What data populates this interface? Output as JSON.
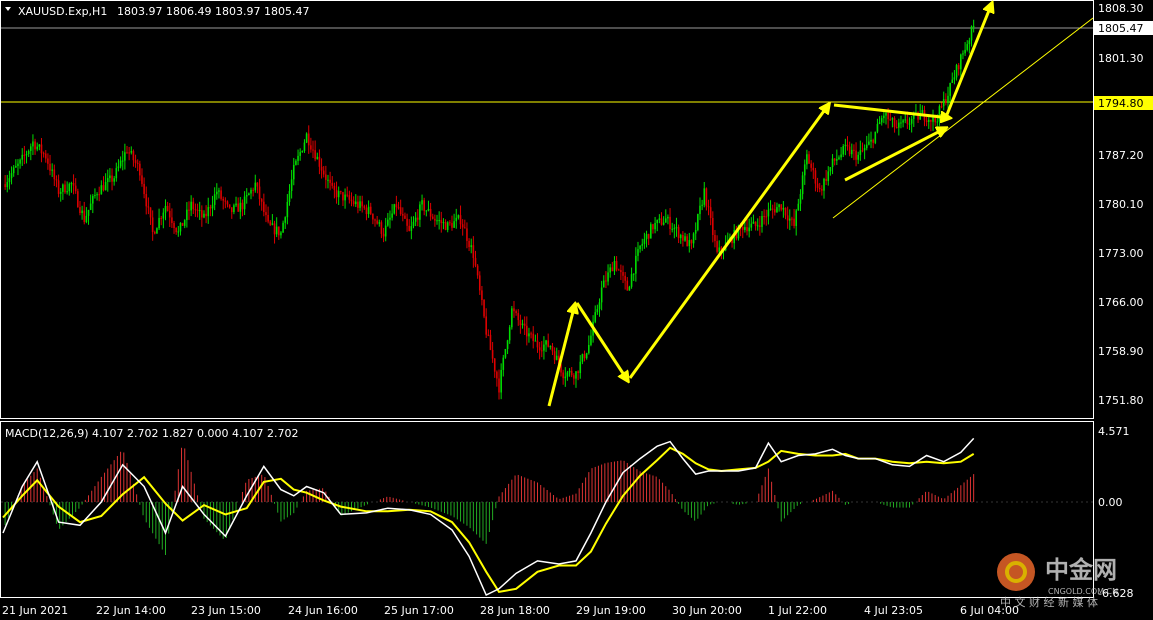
{
  "header": {
    "symbol": "XAUUSD.Exp,H1",
    "ohlc": "1803.97 1806.49 1803.97 1805.47"
  },
  "colors": {
    "background": "#000000",
    "grid_border": "#ffffff",
    "bull": "#00dd00",
    "bear": "#dd0000",
    "annotation": "#ffff00",
    "current_price_line": "#aaaaaa",
    "macd_line": "#ffffff",
    "signal_line": "#ffff00",
    "hist_pos": "#dd3333",
    "hist_neg": "#22aa22"
  },
  "chart_data": [
    {
      "type": "candlestick",
      "title": "XAUUSD.Exp,H1",
      "ylim": [
        1748.5,
        1809.3
      ],
      "y_ticks": [
        "1808.30",
        "1801.30",
        "1787.20",
        "1780.10",
        "1773.00",
        "1766.00",
        "1758.90",
        "1751.80"
      ],
      "x_ticks": [
        "21 Jun 2021",
        "22 Jun 14:00",
        "23 Jun 15:00",
        "24 Jun 16:00",
        "25 Jun 17:00",
        "28 Jun 18:00",
        "29 Jun 19:00",
        "30 Jun 20:00",
        "1 Jul 22:00",
        "4 Jul 23:05",
        "6 Jul 04:00"
      ],
      "current_price": "1805.47",
      "horizontal_level": "1794.80",
      "anchors": [
        [
          0,
          1783
        ],
        [
          8,
          1786
        ],
        [
          14,
          1789
        ],
        [
          20,
          1787
        ],
        [
          26,
          1782
        ],
        [
          32,
          1783
        ],
        [
          38,
          1778
        ],
        [
          44,
          1782
        ],
        [
          52,
          1784
        ],
        [
          58,
          1788
        ],
        [
          64,
          1785
        ],
        [
          70,
          1776
        ],
        [
          76,
          1780
        ],
        [
          82,
          1776
        ],
        [
          88,
          1780
        ],
        [
          94,
          1778
        ],
        [
          100,
          1782
        ],
        [
          106,
          1779
        ],
        [
          112,
          1780
        ],
        [
          118,
          1783
        ],
        [
          124,
          1777
        ],
        [
          130,
          1776
        ],
        [
          136,
          1785
        ],
        [
          142,
          1790
        ],
        [
          148,
          1786
        ],
        [
          154,
          1782
        ],
        [
          160,
          1781
        ],
        [
          166,
          1780
        ],
        [
          172,
          1779
        ],
        [
          178,
          1776
        ],
        [
          184,
          1780
        ],
        [
          190,
          1776
        ],
        [
          196,
          1780
        ],
        [
          202,
          1778
        ],
        [
          208,
          1777
        ],
        [
          214,
          1778
        ],
        [
          220,
          1773
        ],
        [
          226,
          1762
        ],
        [
          232,
          1754
        ],
        [
          238,
          1765
        ],
        [
          244,
          1762
        ],
        [
          250,
          1760
        ],
        [
          256,
          1760
        ],
        [
          262,
          1756
        ],
        [
          268,
          1756
        ],
        [
          274,
          1760
        ],
        [
          280,
          1768
        ],
        [
          286,
          1772
        ],
        [
          292,
          1768
        ],
        [
          298,
          1774
        ],
        [
          304,
          1777
        ],
        [
          310,
          1778
        ],
        [
          316,
          1776
        ],
        [
          322,
          1774
        ],
        [
          328,
          1782
        ],
        [
          334,
          1773
        ],
        [
          340,
          1775
        ],
        [
          346,
          1777
        ],
        [
          352,
          1777
        ],
        [
          358,
          1779
        ],
        [
          364,
          1780
        ],
        [
          370,
          1777
        ],
        [
          376,
          1787
        ],
        [
          382,
          1782
        ],
        [
          388,
          1786
        ],
        [
          394,
          1788
        ],
        [
          400,
          1787
        ],
        [
          406,
          1789
        ],
        [
          412,
          1793
        ],
        [
          418,
          1791
        ],
        [
          424,
          1792
        ],
        [
          430,
          1793
        ],
        [
          436,
          1792
        ],
        [
          442,
          1796
        ],
        [
          448,
          1801
        ],
        [
          454,
          1805.5
        ]
      ],
      "annotations": [
        "upward arrows",
        "channel lines",
        "trend line"
      ]
    },
    {
      "type": "line",
      "title": "MACD(12,26,9) 4.107 2.702 1.827 0.000 4.107 2.702",
      "y_ticks": [
        "4.571",
        "0.00",
        "-6.628"
      ],
      "ylim": [
        -6.628,
        4.571
      ],
      "series": [
        {
          "values": [
            [
              0,
              -2.0
            ],
            [
              9,
              1.0
            ],
            [
              16,
              2.6
            ],
            [
              26,
              -1.3
            ],
            [
              36,
              -1.5
            ],
            [
              46,
              0.0
            ],
            [
              56,
              2.4
            ],
            [
              66,
              1.0
            ],
            [
              76,
              -2.0
            ],
            [
              84,
              1.0
            ],
            [
              94,
              -0.8
            ],
            [
              104,
              -2.2
            ],
            [
              114,
              0.4
            ],
            [
              122,
              2.3
            ],
            [
              130,
              0.8
            ],
            [
              136,
              0.4
            ],
            [
              142,
              1.0
            ],
            [
              150,
              0.6
            ],
            [
              158,
              -0.8
            ],
            [
              170,
              -0.7
            ],
            [
              180,
              -0.4
            ],
            [
              190,
              -0.5
            ],
            [
              200,
              -0.8
            ],
            [
              210,
              -1.8
            ],
            [
              218,
              -3.5
            ],
            [
              226,
              -6.0
            ],
            [
              232,
              -5.6
            ],
            [
              240,
              -4.6
            ],
            [
              250,
              -3.8
            ],
            [
              260,
              -4.0
            ],
            [
              268,
              -3.8
            ],
            [
              275,
              -2.0
            ],
            [
              282,
              0.0
            ],
            [
              290,
              1.9
            ],
            [
              298,
              2.8
            ],
            [
              306,
              3.6
            ],
            [
              312,
              3.9
            ],
            [
              318,
              2.8
            ],
            [
              324,
              1.8
            ],
            [
              330,
              2.0
            ],
            [
              336,
              2.0
            ],
            [
              344,
              2.0
            ],
            [
              352,
              2.2
            ],
            [
              358,
              3.8
            ],
            [
              364,
              2.6
            ],
            [
              372,
              3.0
            ],
            [
              380,
              3.1
            ],
            [
              388,
              3.4
            ],
            [
              394,
              3.0
            ],
            [
              400,
              2.8
            ],
            [
              408,
              2.8
            ],
            [
              416,
              2.4
            ],
            [
              424,
              2.3
            ],
            [
              432,
              3.0
            ],
            [
              440,
              2.6
            ],
            [
              448,
              3.2
            ],
            [
              454,
              4.1
            ]
          ]
        },
        {
          "values": [
            [
              0,
              -1.0
            ],
            [
              9,
              0.4
            ],
            [
              16,
              1.4
            ],
            [
              26,
              -0.3
            ],
            [
              36,
              -1.3
            ],
            [
              46,
              -0.9
            ],
            [
              56,
              0.5
            ],
            [
              66,
              1.6
            ],
            [
              76,
              -0.1
            ],
            [
              84,
              -1.2
            ],
            [
              94,
              -0.2
            ],
            [
              104,
              -0.8
            ],
            [
              114,
              -0.4
            ],
            [
              122,
              1.3
            ],
            [
              130,
              1.5
            ],
            [
              136,
              0.8
            ],
            [
              142,
              0.6
            ],
            [
              150,
              0.1
            ],
            [
              158,
              -0.3
            ],
            [
              170,
              -0.6
            ],
            [
              180,
              -0.6
            ],
            [
              190,
              -0.5
            ],
            [
              200,
              -0.6
            ],
            [
              210,
              -1.3
            ],
            [
              218,
              -2.6
            ],
            [
              226,
              -4.5
            ],
            [
              232,
              -5.8
            ],
            [
              240,
              -5.6
            ],
            [
              250,
              -4.5
            ],
            [
              260,
              -4.1
            ],
            [
              268,
              -4.1
            ],
            [
              275,
              -3.2
            ],
            [
              282,
              -1.4
            ],
            [
              290,
              0.4
            ],
            [
              298,
              1.7
            ],
            [
              306,
              2.7
            ],
            [
              312,
              3.5
            ],
            [
              318,
              3.1
            ],
            [
              324,
              2.5
            ],
            [
              330,
              2.1
            ],
            [
              336,
              2.0
            ],
            [
              344,
              2.1
            ],
            [
              352,
              2.2
            ],
            [
              358,
              2.6
            ],
            [
              364,
              3.3
            ],
            [
              372,
              3.1
            ],
            [
              380,
              3.0
            ],
            [
              388,
              3.0
            ],
            [
              394,
              3.1
            ],
            [
              400,
              2.8
            ],
            [
              408,
              2.8
            ],
            [
              416,
              2.6
            ],
            [
              424,
              2.5
            ],
            [
              432,
              2.6
            ],
            [
              440,
              2.5
            ],
            [
              448,
              2.6
            ],
            [
              454,
              3.1
            ]
          ]
        }
      ]
    }
  ],
  "watermark": {
    "brand": "中金网",
    "url": "CNGOLD.COM.CN",
    "tagline": "中 文 财 经 新 媒 体"
  }
}
